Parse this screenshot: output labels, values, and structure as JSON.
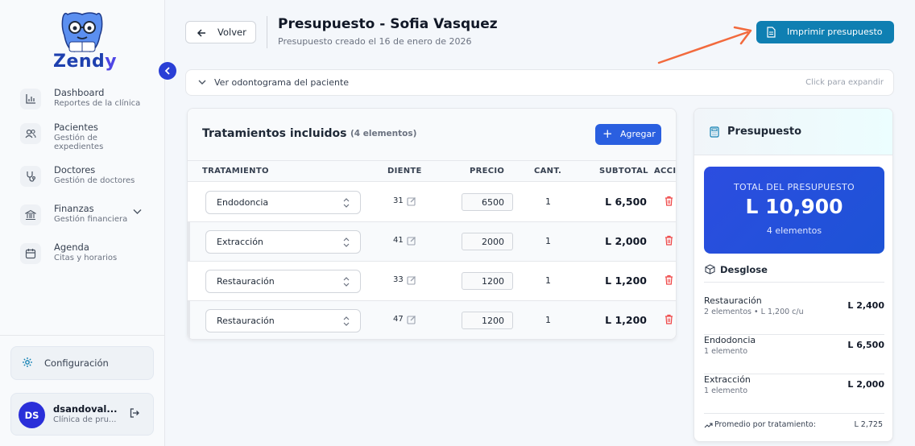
{
  "brand": {
    "name_a": "Zend",
    "name_b": "y"
  },
  "sidebar": {
    "items": [
      {
        "title": "Dashboard",
        "sub": "Reportes de la clínica",
        "icon": "bar-chart-icon"
      },
      {
        "title": "Pacientes",
        "sub": "Gestión de expedientes",
        "icon": "users-icon"
      },
      {
        "title": "Doctores",
        "sub": "Gestión de doctores",
        "icon": "stethoscope-icon"
      },
      {
        "title": "Finanzas",
        "sub": "Gestión financiera",
        "icon": "bank-icon"
      },
      {
        "title": "Agenda",
        "sub": "Citas y horarios",
        "icon": "calendar-icon"
      }
    ],
    "config_label": "Configuración",
    "user": {
      "initials": "DS",
      "name": "dsandoval...",
      "clinic": "Clínica de pru..."
    }
  },
  "header": {
    "back_label": "Volver",
    "title": "Presupuesto - Sofia Vasquez",
    "subtitle": "Presupuesto creado el 16 de enero de 2026",
    "print_label": "Imprimir presupuesto"
  },
  "odontogram": {
    "label": "Ver odontograma del paciente",
    "hint": "Click para expandir"
  },
  "treatments": {
    "title": "Tratamientos incluidos",
    "count": "(4 elementos)",
    "add_label": "Agregar",
    "columns": {
      "treatment": "TRATAMIENTO",
      "tooth": "DIENTE",
      "price": "PRECIO",
      "qty": "CANT.",
      "subtotal": "SUBTOTAL",
      "actions": "ACCIO"
    },
    "rows": [
      {
        "treatment": "Endodoncia",
        "tooth": "31",
        "price": "6500",
        "qty": "1",
        "subtotal": "L 6,500"
      },
      {
        "treatment": "Extracción",
        "tooth": "41",
        "price": "2000",
        "qty": "1",
        "subtotal": "L 2,000"
      },
      {
        "treatment": "Restauración",
        "tooth": "33",
        "price": "1200",
        "qty": "1",
        "subtotal": "L 1,200"
      },
      {
        "treatment": "Restauración",
        "tooth": "47",
        "price": "1200",
        "qty": "1",
        "subtotal": "L 1,200"
      }
    ]
  },
  "summary": {
    "title": "Presupuesto",
    "total_label": "TOTAL DEL PRESUPUESTO",
    "total_value": "L 10,900",
    "total_items": "4 elementos",
    "breakdown_label": "Desglose",
    "breakdown": [
      {
        "name": "Restauración",
        "sub": "2 elementos  • L 1,200 c/u",
        "value": "L 2,400"
      },
      {
        "name": "Endodoncia",
        "sub": "1 elemento",
        "value": "L 6,500"
      },
      {
        "name": "Extracción",
        "sub": "1 elemento",
        "value": "L 2,000"
      }
    ],
    "avg_label": "Promedio por tratamiento:",
    "avg_value": "L 2,725"
  },
  "colors": {
    "primary": "#2a5fe0",
    "print": "#0f7fb2",
    "danger": "#ef4444",
    "arrow": "#f26a3d"
  }
}
